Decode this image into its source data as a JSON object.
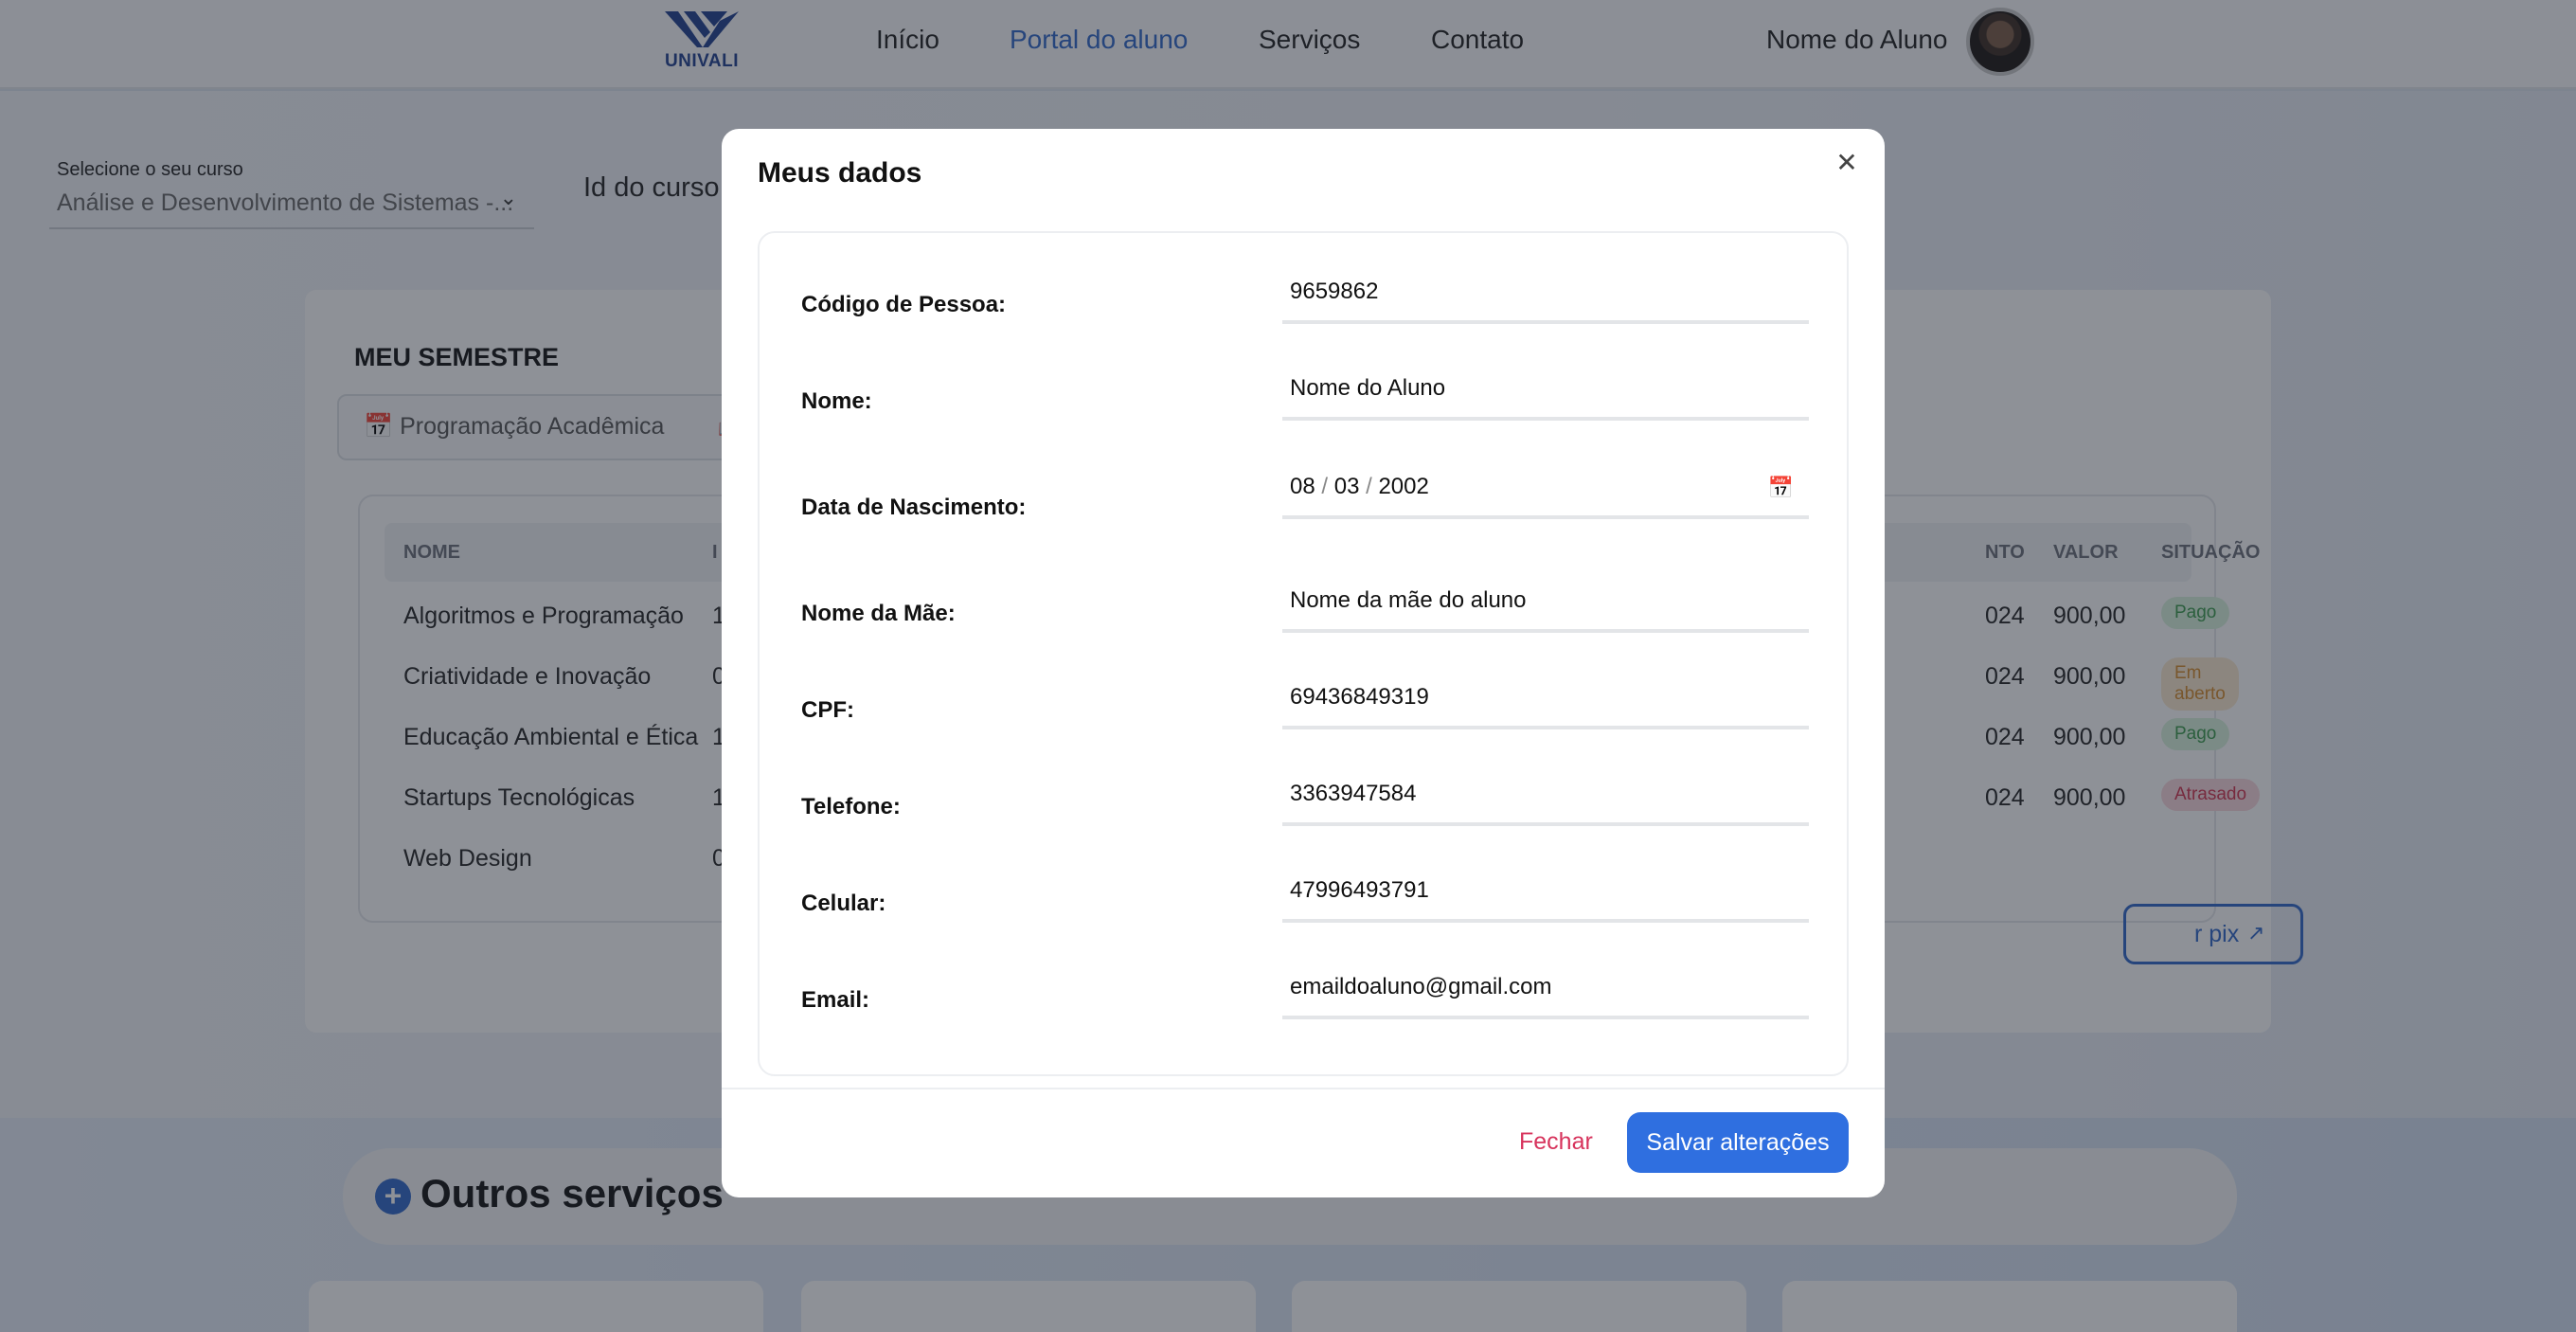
{
  "navbar": {
    "logo_text": "UNIVALI",
    "links": [
      "Início",
      "Portal do aluno",
      "Serviços",
      "Contato"
    ],
    "active_link": "Portal do aluno",
    "user_name": "Nome do Aluno"
  },
  "course": {
    "select_label": "Selecione o seu curso",
    "select_value": "Análise e Desenvolvimento de Sistemas -...",
    "id_label": "Id do curso:"
  },
  "semester": {
    "title": "MEU SEMESTRE",
    "tab_label": "Programação Acadêmica",
    "columns": {
      "name": "NOME",
      "col2": "I",
      "due": "NTO",
      "value": "VALOR",
      "status": "SITUAÇÃO"
    },
    "rows": [
      {
        "name": "Algoritmos e Programação",
        "col2": "1",
        "due": "024",
        "value": "900,00",
        "status": "Pago"
      },
      {
        "name": "Criatividade e Inovação",
        "col2": "0",
        "due": "024",
        "value": "900,00",
        "status": "Em aberto"
      },
      {
        "name": "Educação Ambiental e Ética",
        "col2": "1",
        "due": "024",
        "value": "900,00",
        "status": "Pago"
      },
      {
        "name": "Startups Tecnológicas",
        "col2": "1",
        "due": "024",
        "value": "900,00",
        "status": "Atrasado"
      },
      {
        "name": "Web Design",
        "col2": "0"
      }
    ],
    "pix_label": "r pix"
  },
  "services": {
    "title": "Outros serviços"
  },
  "modal": {
    "title": "Meus dados",
    "fields": {
      "codigo": {
        "label": "Código de Pessoa:",
        "value": "9659862"
      },
      "nome": {
        "label": "Nome:",
        "value": "Nome do Aluno"
      },
      "nascimento": {
        "label": "Data de Nascimento:",
        "day": "08",
        "month": "03",
        "year": "2002"
      },
      "mae": {
        "label": "Nome da Mãe:",
        "value": "Nome da mãe do aluno"
      },
      "cpf": {
        "label": "CPF:",
        "value": "69436849319"
      },
      "telefone": {
        "label": "Telefone:",
        "value": "3363947584"
      },
      "celular": {
        "label": "Celular:",
        "value": "47996493791"
      },
      "email": {
        "label": "Email:",
        "value": "emaildoaluno@gmail.com"
      }
    },
    "close_label": "Fechar",
    "save_label": "Salvar alterações"
  },
  "colors": {
    "primary": "#2f6fe0",
    "danger": "#d7335c",
    "paid": "#3a9b4d",
    "open": "#d48a2a",
    "late": "#d1334f"
  }
}
